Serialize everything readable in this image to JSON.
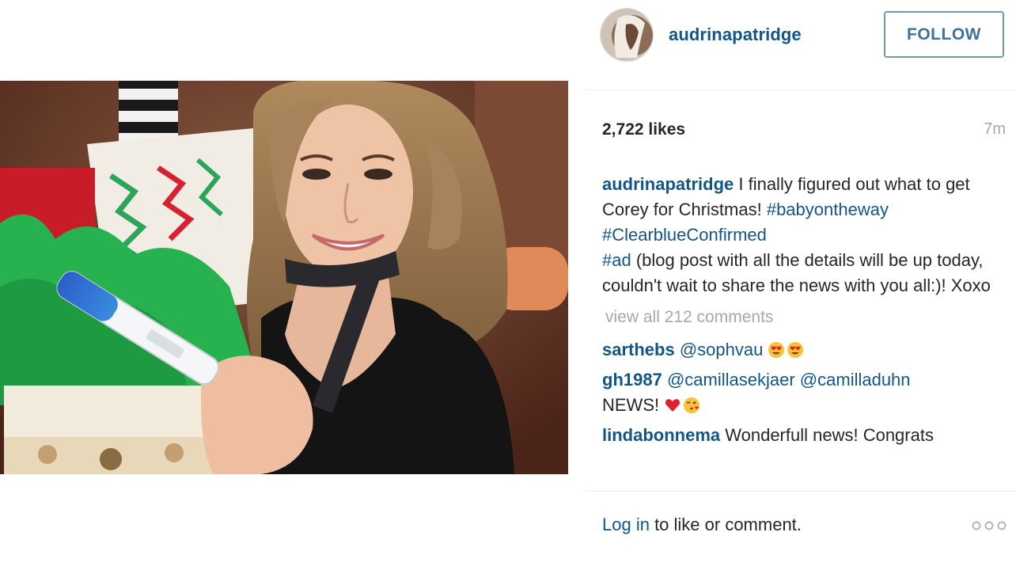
{
  "post": {
    "image_alt": "Woman holding a pregnancy test in front of Christmas gift bags"
  },
  "header": {
    "username": "audrinapatridge",
    "follow_label": "FOLLOW"
  },
  "stats": {
    "likes": "2,722 likes",
    "time_ago": "7m"
  },
  "caption": {
    "user": "audrinapatridge",
    "text_1": " I finally figured out what to get Corey for Christmas! ",
    "hashtag_1": "#babyontheway",
    "space": " ",
    "hashtag_2": "#ClearblueConfirmed",
    "hashtag_3": "#ad",
    "text_2": " (blog post with all the details will be up today, couldn't wait to share the news with you all:)! Xoxo"
  },
  "view_all_comments": "view all 212 comments",
  "comments": [
    {
      "user": "sarthebs",
      "mention": "@sophvau",
      "text": "",
      "emojis": [
        "heart-eyes-icon",
        "heart-eyes-icon"
      ]
    },
    {
      "user": "gh1987",
      "mention": "@camillasekjaer",
      "mention_2": "@camilladuhn",
      "text": "NEWS!",
      "emojis": [
        "red-heart-icon",
        "kiss-face-icon"
      ]
    },
    {
      "user": "lindabonnema",
      "text": "Wonderfull news! Congrats"
    }
  ],
  "footer": {
    "login_label": "Log in",
    "prompt": " to like or comment."
  },
  "colors": {
    "link": "#125688",
    "follow_border": "#6f97b6",
    "follow_text": "#3f729b",
    "muted": "#a5a7aa",
    "text": "#262626"
  },
  "icons": {
    "more": "more-options-icon"
  }
}
